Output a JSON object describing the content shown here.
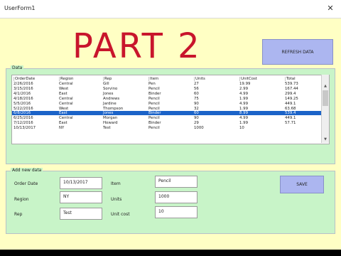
{
  "window": {
    "title": "UserForm1"
  },
  "overlay_text": "PART 2",
  "buttons": {
    "refresh": "REFRESH DATA",
    "save": "SAVE"
  },
  "data_frame": {
    "label": "Data",
    "columns": [
      "OrderDate",
      "Region",
      "Rep",
      "Item",
      "Units",
      "UnitCost",
      "Total"
    ],
    "selected_index": 6,
    "rows": [
      [
        "2/26/2016",
        "Central",
        "Gill",
        "Pen",
        "27",
        "19.99",
        "539.73"
      ],
      [
        "3/15/2016",
        "West",
        "Sorvino",
        "Pencil",
        "56",
        "2.99",
        "167.44"
      ],
      [
        "4/1/2016",
        "East",
        "Jones",
        "Binder",
        "60",
        "4.99",
        "299.4"
      ],
      [
        "4/18/2016",
        "Central",
        "Andrews",
        "Pencil",
        "75",
        "1.99",
        "149.25"
      ],
      [
        "5/5/2016",
        "Central",
        "Jardine",
        "Pencil",
        "90",
        "4.99",
        "449.1"
      ],
      [
        "5/22/2016",
        "West",
        "Thompson",
        "Pencil",
        "32",
        "1.99",
        "63.68"
      ],
      [
        "6/8/2016",
        "East",
        "Jones",
        "Binder",
        "60",
        "8.99",
        "539.4"
      ],
      [
        "6/25/2016",
        "Central",
        "Morgan",
        "Pencil",
        "90",
        "4.99",
        "449.1"
      ],
      [
        "7/12/2016",
        "East",
        "Howard",
        "Binder",
        "29",
        "1.99",
        "57.71"
      ],
      [
        "10/13/2017",
        "NY",
        "Test",
        "Pencil",
        "1000",
        "10",
        ""
      ]
    ]
  },
  "new_data_frame": {
    "label": "Add new data",
    "order_date_label": "Order Date",
    "order_date_value": "10/13/2017",
    "region_label": "Region",
    "region_value": "NY",
    "rep_label": "Rep",
    "rep_value": "Test",
    "item_label": "Item",
    "item_value": "Pencil",
    "units_label": "Units",
    "units_value": "1000",
    "unit_cost_label": "Unit cost",
    "unit_cost_value": "10"
  }
}
